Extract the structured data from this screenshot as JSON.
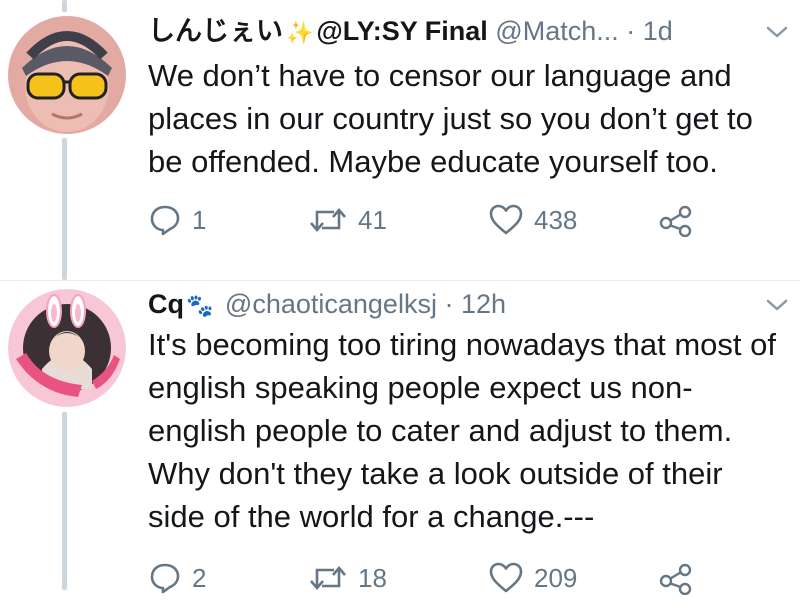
{
  "tweets": [
    {
      "name": "しんじぇい",
      "badge_icon": "sparkle-icon",
      "display_suffix": "@LY:SY Final",
      "handle": "@Match...",
      "separator": "·",
      "time": "1d",
      "text": "We don’t have to censor our language and places in our country just so you don’t get to be offended. Maybe educate yourself too.",
      "replies": "1",
      "retweets": "41",
      "likes": "438"
    },
    {
      "name": "Cq",
      "badge_icon": "paw-icon",
      "handle": "@chaoticangelksj",
      "separator": "·",
      "time": "12h",
      "text": "It's becoming too tiring nowadays that most of english speaking people expect us non-english people to cater and adjust to them. Why don't they take a look outside of their side of the world for a change.---",
      "replies": "2",
      "retweets": "18",
      "likes": "209"
    }
  ],
  "colors": {
    "text": "#14171a",
    "muted": "#657786",
    "thread_line": "#ccd6dd",
    "sparkle": "#f7c02b"
  }
}
